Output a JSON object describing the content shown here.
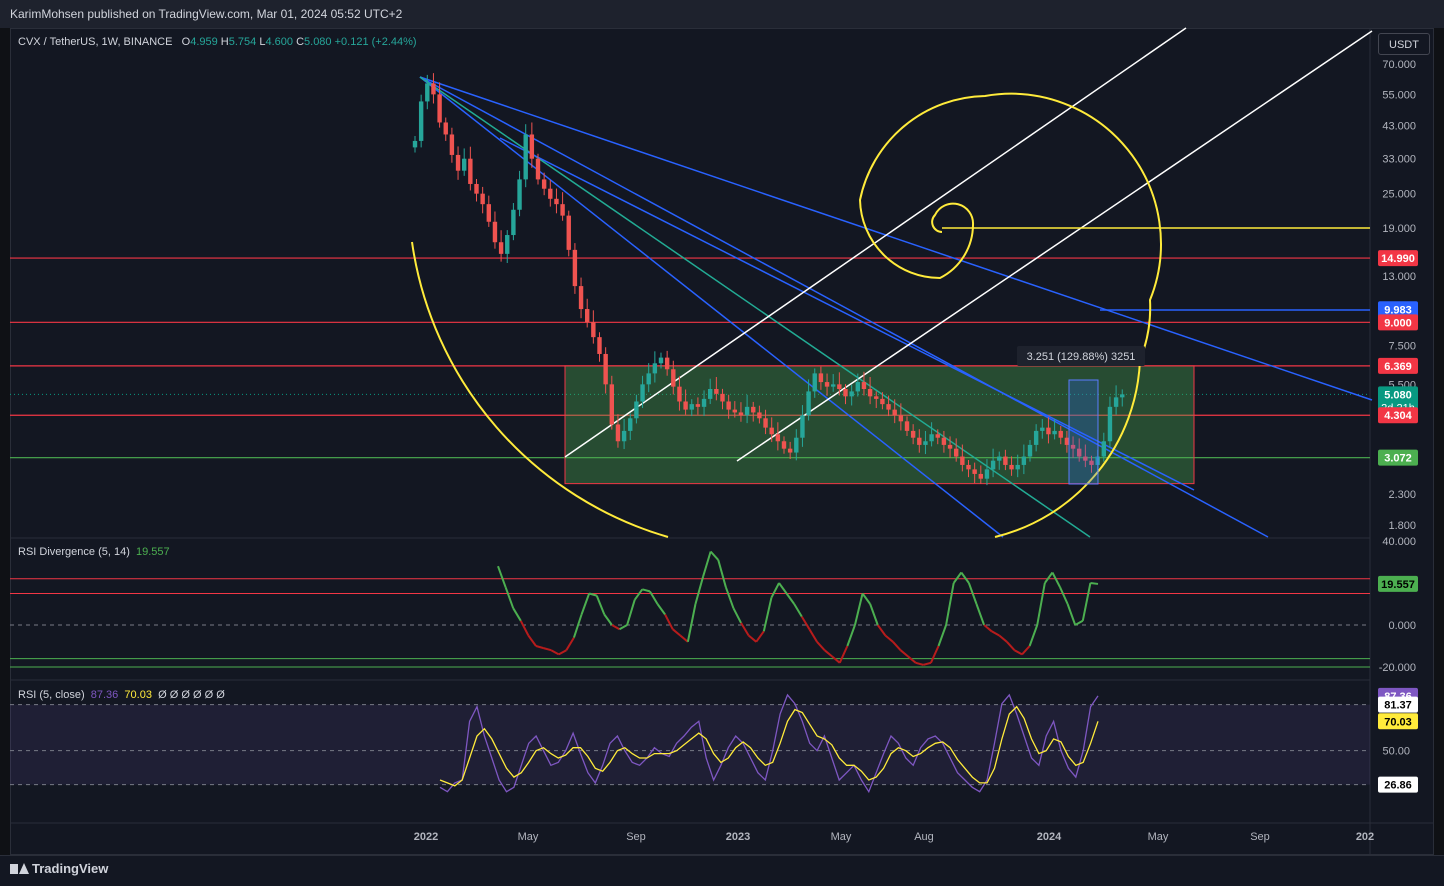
{
  "header": {
    "publisher_text": "KarimMohsen published on TradingView.com, Mar 01, 2024 05:52 UTC+2",
    "currency_button": "USDT",
    "footer_logo": "TradingView"
  },
  "legend": {
    "symbol": "CVX / TetherUS, 1W, BINANCE",
    "open_label": "O",
    "open": "4.959",
    "high_label": "H",
    "high": "5.754",
    "low_label": "L",
    "low": "4.600",
    "close_label": "C",
    "close": "5.080",
    "change": "+0.121 (+2.44%)"
  },
  "colors": {
    "background": "#131722",
    "up_candle": "#26a69a",
    "down_candle": "#ef5350",
    "resistance_line": "#f23645",
    "support_line": "#4caf50",
    "blue_trendline": "#2962ff",
    "teal_trendline": "#22ab94",
    "fib_spiral": "#ffeb3b",
    "channel_line": "#ffffff",
    "rsi_line": "#7e57c2",
    "rsi_ma": "#ffeb3b"
  },
  "chart_data": [
    {
      "type": "candlestick",
      "title": "CVX / TetherUS, 1W, BINANCE",
      "scale": "log",
      "ylim": [
        1.6,
        80
      ],
      "y_ticks": [
        "70.000",
        "55.000",
        "43.000",
        "33.000",
        "25.000",
        "19.000",
        "13.000",
        "7.500",
        "5.500",
        "2.300",
        "1.800"
      ],
      "x_ticks": [
        "2022",
        "May",
        "Sep",
        "2023",
        "May",
        "Aug",
        "2024",
        "May",
        "Sep",
        "202"
      ],
      "horizontal_levels": [
        {
          "value": "14.990",
          "color": "#f23645"
        },
        {
          "value": "9.000",
          "color": "#f23645"
        },
        {
          "value": "6.369",
          "color": "#f23645"
        },
        {
          "value": "4.304",
          "color": "#f23645"
        },
        {
          "value": "3.072",
          "color": "#4caf50"
        }
      ],
      "price_labels": [
        {
          "value": "14.990",
          "color": "#f23645"
        },
        {
          "value": "9.983",
          "color": "#2962ff"
        },
        {
          "value": "9.000",
          "color": "#f23645"
        },
        {
          "value": "6.369",
          "color": "#f23645"
        },
        {
          "value": "5.080",
          "sub": "2d 21h",
          "color": "#089981"
        },
        {
          "value": "4.304",
          "color": "#f23645"
        },
        {
          "value": "3.072",
          "color": "#4caf50"
        }
      ],
      "range_box": {
        "top": 6.369,
        "bottom": 2.5
      },
      "measure_label": "3.251 (129.88%) 3251",
      "last_price": 5.08,
      "series": [
        {
          "name": "CVX",
          "close": [
            38,
            52,
            60,
            55,
            44,
            40,
            34,
            30,
            33,
            27,
            25,
            23,
            20,
            17,
            15.5,
            18,
            22,
            28,
            40,
            33,
            28,
            26,
            24,
            23,
            21,
            16,
            12,
            10,
            9,
            8,
            7,
            5.5,
            4,
            3.5,
            3.8,
            4.2,
            4.8,
            5.5,
            6,
            6.5,
            6.8,
            6.2,
            5.4,
            4.8,
            4.5,
            4.7,
            4.6,
            4.9,
            5.3,
            5.1,
            4.8,
            4.5,
            4.4,
            4.3,
            4.6,
            4.4,
            4.2,
            3.9,
            3.7,
            3.5,
            3.3,
            3.2,
            3.6,
            4.3,
            5.2,
            6.0,
            5.6,
            5.4,
            5.5,
            5.3,
            5.0,
            5.2,
            5.6,
            5.3,
            5.0,
            4.9,
            4.7,
            4.5,
            4.3,
            4.1,
            3.8,
            3.6,
            3.4,
            3.5,
            3.7,
            3.6,
            3.4,
            3.3,
            3.1,
            2.9,
            2.8,
            2.7,
            2.6,
            2.8,
            3.0,
            3.1,
            2.9,
            2.8,
            2.9,
            3.1,
            3.4,
            3.8,
            3.9,
            3.7,
            3.8,
            3.6,
            3.4,
            3.3,
            3.1,
            3.0,
            2.9,
            3.1,
            3.5,
            4.6,
            4.96,
            5.08
          ]
        }
      ]
    },
    {
      "type": "line",
      "title": "RSI Divergence (5, 14)",
      "current": "19.557",
      "y_ticks": [
        "40.000",
        "0.000",
        "-20.000"
      ],
      "levels": [
        22,
        15,
        0,
        -16,
        -20
      ],
      "series": [
        {
          "name": "RSI Divergence",
          "values": [
            28,
            18,
            8,
            2,
            -5,
            -10,
            -11,
            -12,
            -14,
            -12,
            -6,
            5,
            15,
            14,
            5,
            0,
            -2,
            0,
            12,
            17,
            16,
            10,
            5,
            -2,
            -5,
            -8,
            10,
            23,
            35,
            31,
            18,
            8,
            1,
            -5,
            -8,
            -3,
            13,
            20,
            15,
            10,
            4,
            -2,
            -8,
            -12,
            -15,
            -18,
            -10,
            0,
            15,
            10,
            0,
            -5,
            -8,
            -12,
            -15,
            -18,
            -19,
            -18,
            -10,
            0,
            20,
            25,
            20,
            10,
            0,
            -3,
            -5,
            -8,
            -12,
            -14,
            -10,
            0,
            20,
            25,
            18,
            10,
            0,
            2,
            20,
            19.557
          ]
        }
      ]
    },
    {
      "type": "line",
      "title": "RSI (5, close)",
      "rsi": "87.36",
      "ma": "70.03",
      "na_values": [
        "Ø",
        "Ø",
        "Ø",
        "Ø",
        "Ø",
        "Ø"
      ],
      "y_ticks": [
        "50.00"
      ],
      "band": {
        "upper": "81.37",
        "lower": "26.86"
      },
      "series": [
        {
          "name": "RSI",
          "values": [
            25,
            22,
            28,
            30,
            70,
            80,
            60,
            45,
            30,
            22,
            25,
            40,
            55,
            60,
            50,
            40,
            42,
            50,
            62,
            48,
            35,
            28,
            40,
            55,
            60,
            50,
            42,
            40,
            45,
            52,
            48,
            46,
            55,
            60,
            66,
            70,
            45,
            30,
            40,
            52,
            60,
            55,
            45,
            35,
            30,
            50,
            75,
            88,
            82,
            70,
            55,
            50,
            60,
            45,
            30,
            35,
            40,
            30,
            22,
            35,
            48,
            60,
            55,
            45,
            40,
            52,
            58,
            60,
            55,
            45,
            35,
            30,
            25,
            22,
            30,
            55,
            82,
            88,
            75,
            60,
            45,
            40,
            60,
            70,
            50,
            38,
            32,
            50,
            80,
            87.36
          ]
        },
        {
          "name": "MA",
          "values": [
            30,
            28,
            26,
            30,
            45,
            60,
            65,
            58,
            48,
            38,
            32,
            35,
            42,
            50,
            52,
            48,
            45,
            47,
            52,
            52,
            46,
            38,
            36,
            42,
            50,
            52,
            48,
            45,
            45,
            48,
            48,
            48,
            50,
            54,
            58,
            62,
            58,
            48,
            42,
            45,
            52,
            56,
            52,
            45,
            40,
            42,
            55,
            70,
            78,
            76,
            68,
            60,
            58,
            54,
            45,
            40,
            40,
            36,
            30,
            32,
            38,
            48,
            52,
            50,
            46,
            48,
            52,
            55,
            56,
            52,
            44,
            38,
            32,
            28,
            28,
            38,
            58,
            75,
            80,
            72,
            58,
            48,
            50,
            58,
            56,
            46,
            40,
            42,
            55,
            70.03
          ]
        }
      ]
    }
  ]
}
